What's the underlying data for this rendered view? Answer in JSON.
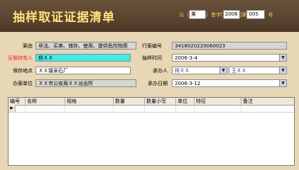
{
  "header": {
    "title": "抽样取证证据清单",
    "number_prefix": "公（",
    "agency_value": "某",
    "mid_text": "）查字[",
    "year_value": "2006",
    "mid_text2": "]第",
    "serial_value": "005",
    "suffix": "号"
  },
  "form": {
    "cause_label": "案由",
    "cause_value": "非法、买卖、储存、使用、提供危险物质",
    "case_no_label": "行案编号",
    "case_no_value": "3418020220060023",
    "holder_label": "证据持有人",
    "holder_value": "杨ＸＸ",
    "sample_time_label": "抽样时间",
    "sample_time_value": "2006-3-4",
    "storage_label": "保存地点",
    "storage_value": "ＸＸ镇采石厂",
    "handler_label": "承办人",
    "handler1_value": "柯ＸＸ",
    "handler2_value": "王ＸＸ",
    "unit_label": "办案单位",
    "unit_value": "ＸＸ市公安局ＸＸ派出所",
    "date_label": "承办日期",
    "date_value": "2006-3-12"
  },
  "table": {
    "columns": [
      "编号",
      "名称",
      "规格",
      "数量",
      "数量小写",
      "单位",
      "特征",
      "备注"
    ],
    "new_row_marker": "▶"
  },
  "icons": {
    "dropdown": "chevron-down-icon"
  },
  "colors": {
    "header_bg": "#5a4430",
    "title_color": "#ffe27a",
    "form_bg": "#e7d7b4",
    "required_label": "#ff2020",
    "highlight_field": "#40ecec"
  }
}
